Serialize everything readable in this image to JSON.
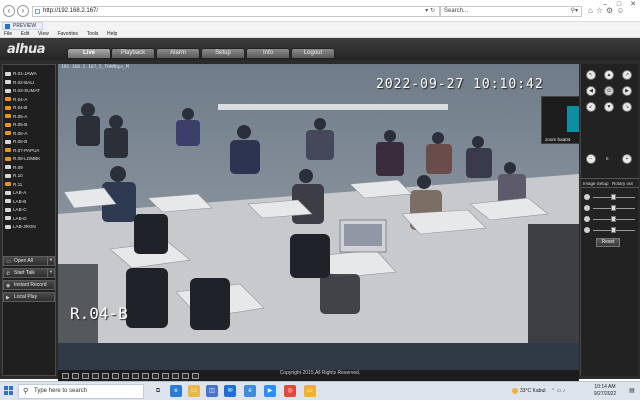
{
  "browser": {
    "url": "http://192.168.2.167/",
    "search_placeholder": "Search...",
    "tab_title": "PREVIEW",
    "menu": [
      "File",
      "Edit",
      "View",
      "Favorites",
      "Tools",
      "Help"
    ]
  },
  "app": {
    "logo": "alhua",
    "nav": [
      "Live",
      "Playback",
      "Alarm",
      "Setup",
      "Info",
      "Logout"
    ],
    "active_nav": "Live",
    "channels": [
      {
        "label": "R.01-JAWA",
        "live": false
      },
      {
        "label": "R.02-BALI",
        "live": false
      },
      {
        "label": "R.03-SUMAT",
        "live": false
      },
      {
        "label": "R.04-A",
        "live": true
      },
      {
        "label": "R.04-B",
        "live": true
      },
      {
        "label": "R.05-A",
        "live": true
      },
      {
        "label": "R.05-B",
        "live": true
      },
      {
        "label": "R.06-A",
        "live": true
      },
      {
        "label": "R.06-B",
        "live": false
      },
      {
        "label": "R.07-PAPUA",
        "live": true
      },
      {
        "label": "R.08-LOMBK",
        "live": true
      },
      {
        "label": "R.09",
        "live": false
      },
      {
        "label": "R.10",
        "live": false
      },
      {
        "label": "R.11",
        "live": true
      },
      {
        "label": "LAB-A",
        "live": false
      },
      {
        "label": "LAB-B",
        "live": false
      },
      {
        "label": "LAB-C",
        "live": false
      },
      {
        "label": "LAB-D",
        "live": false
      },
      {
        "label": "LAB-JRGN",
        "live": false
      }
    ],
    "controls": {
      "open_all": "Open All",
      "start_talk": "Start Talk",
      "instant_record": "Instant Record",
      "local_play": "Local Play"
    },
    "video": {
      "osd_title": "192.168.2.167_5_THAMbps_M",
      "osd_timestamp": "2022-09-27 10:10:42",
      "osd_room": "R.04-B",
      "zoom_avatar": "Z",
      "zoom_name": "zoom baa04"
    },
    "ptz": {
      "zoom_value": "8",
      "image_setup_tab": "Image Setup",
      "rotate_tab": "Rotary out",
      "reset": "Reset"
    },
    "footer": "Copyright 2015,All Rights Reserved."
  },
  "taskbar": {
    "search_placeholder": "Type here to search",
    "weather": "33°C  Kabut",
    "time": "10:14 AM",
    "date": "9/27/2022"
  }
}
